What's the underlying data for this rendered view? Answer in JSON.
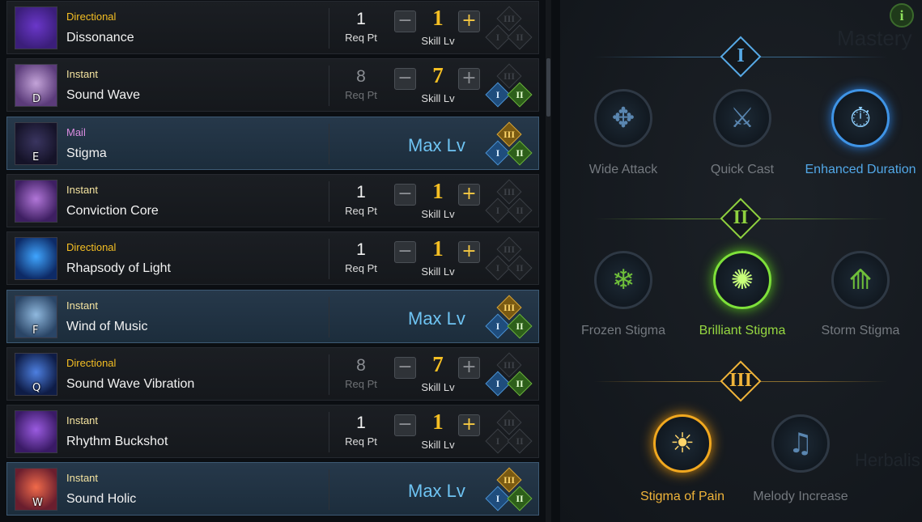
{
  "skills": [
    {
      "type": "Directional",
      "type_color": "#f5bf23",
      "name": "Dissonance",
      "key": "",
      "req": "1",
      "req_label": "Req Pt",
      "level": "1",
      "level_label": "Skill Lv",
      "max": false,
      "gems": [
        false,
        false,
        false
      ],
      "colors": [
        "#6a37c9",
        "#3b1e7a"
      ]
    },
    {
      "type": "Instant",
      "type_color": "#f5e4a0",
      "name": "Sound Wave",
      "key": "D",
      "req": "8",
      "req_label": "Req Pt",
      "level": "7",
      "level_label": "Skill Lv",
      "max": false,
      "dim": true,
      "gems": [
        false,
        true,
        true
      ],
      "colors": [
        "#c3a3d8",
        "#5b3b7a"
      ]
    },
    {
      "type": "Mail",
      "type_color": "#d98ce0",
      "name": "Stigma",
      "key": "E",
      "max": true,
      "max_label": "Max Lv",
      "gems": [
        true,
        true,
        true
      ],
      "colors": [
        "#3a3560",
        "#151328"
      ],
      "selected": true
    },
    {
      "type": "Instant",
      "type_color": "#f5e4a0",
      "name": "Conviction Core",
      "key": "",
      "req": "1",
      "req_label": "Req Pt",
      "level": "1",
      "level_label": "Skill Lv",
      "max": false,
      "gems": [
        false,
        false,
        false
      ],
      "colors": [
        "#b176d8",
        "#3e1f62"
      ]
    },
    {
      "type": "Directional",
      "type_color": "#f5bf23",
      "name": "Rhapsody of Light",
      "key": "",
      "req": "1",
      "req_label": "Req Pt",
      "level": "1",
      "level_label": "Skill Lv",
      "max": false,
      "gems": [
        false,
        false,
        false
      ],
      "colors": [
        "#3fa5ff",
        "#0d2a66"
      ]
    },
    {
      "type": "Instant",
      "type_color": "#f5e4a0",
      "name": "Wind of Music",
      "key": "F",
      "max": true,
      "max_label": "Max Lv",
      "gems": [
        true,
        true,
        true
      ],
      "colors": [
        "#8fb8de",
        "#2a4566"
      ],
      "selected": true
    },
    {
      "type": "Directional",
      "type_color": "#f5bf23",
      "name": "Sound Wave Vibration",
      "key": "Q",
      "req": "8",
      "req_label": "Req Pt",
      "level": "7",
      "level_label": "Skill Lv",
      "max": false,
      "dim": true,
      "gems": [
        false,
        true,
        true
      ],
      "colors": [
        "#4d7fe0",
        "#0e1c46"
      ]
    },
    {
      "type": "Instant",
      "type_color": "#f5e4a0",
      "name": "Rhythm Buckshot",
      "key": "",
      "req": "1",
      "req_label": "Req Pt",
      "level": "1",
      "level_label": "Skill Lv",
      "max": false,
      "gems": [
        false,
        false,
        false
      ],
      "colors": [
        "#9a5be0",
        "#3a1a66"
      ]
    },
    {
      "type": "Instant",
      "type_color": "#f5e4a0",
      "name": "Sound Holic",
      "key": "W",
      "max": true,
      "max_label": "Max Lv",
      "gems": [
        true,
        true,
        true
      ],
      "colors": [
        "#f06a4a",
        "#6a1e2e"
      ],
      "selected": true
    }
  ],
  "tiers": [
    {
      "label": "I",
      "color": "#57a9e6",
      "nodes": [
        {
          "label": "Wide Attack",
          "icon": "wide-attack-icon",
          "state": "off"
        },
        {
          "label": "Quick Cast",
          "icon": "quick-cast-icon",
          "state": "off"
        },
        {
          "label": "Enhanced Duration",
          "icon": "stopwatch-icon",
          "state": "blue"
        }
      ]
    },
    {
      "label": "II",
      "color": "#8fd13f",
      "nodes": [
        {
          "label": "Frozen Stigma",
          "icon": "snowflake-icon",
          "state": "off"
        },
        {
          "label": "Brilliant Stigma",
          "icon": "sunburst-icon",
          "state": "green"
        },
        {
          "label": "Storm Stigma",
          "icon": "tornado-icon",
          "state": "off"
        }
      ]
    },
    {
      "label": "III",
      "color": "#f0b43a",
      "nodes": [
        {
          "label": "Stigma of Pain",
          "icon": "sun-emblem-icon",
          "state": "orange"
        },
        {
          "label": "Melody Increase",
          "icon": "music-notes-icon",
          "state": "off"
        }
      ]
    }
  ],
  "info_label": "i",
  "background_text": [
    "Mastery",
    "Herbalis"
  ]
}
